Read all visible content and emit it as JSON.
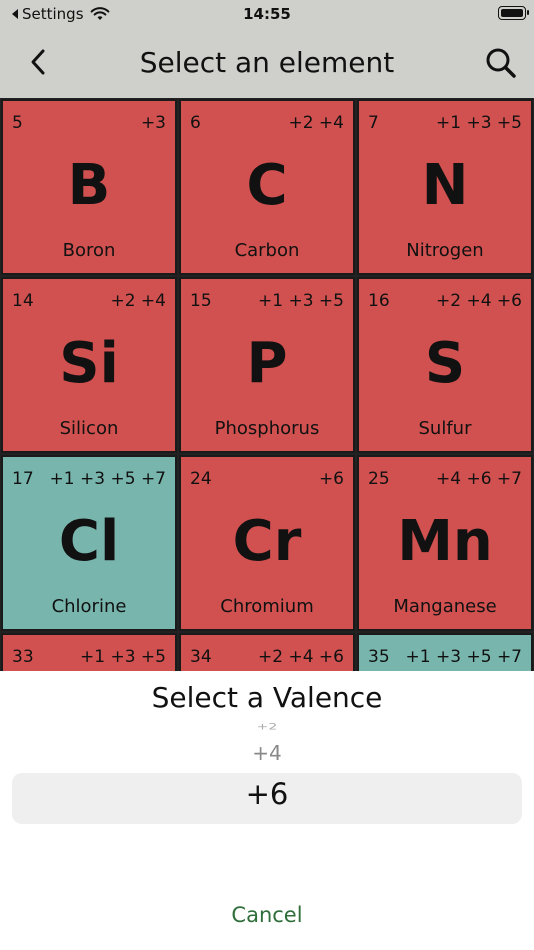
{
  "status_bar": {
    "back_app": "Settings",
    "time": "14:55"
  },
  "nav": {
    "title": "Select an element",
    "back_icon": "chevron-left-icon",
    "search_icon": "search-icon"
  },
  "colors": {
    "nonmetal": "#d05150",
    "halogen": "#78b6ad",
    "accent": "#2f6e3a"
  },
  "elements": [
    {
      "number": "5",
      "valences": "+3",
      "symbol": "B",
      "name": "Boron",
      "category": "red"
    },
    {
      "number": "6",
      "valences": "+2 +4",
      "symbol": "C",
      "name": "Carbon",
      "category": "red"
    },
    {
      "number": "7",
      "valences": "+1 +3 +5",
      "symbol": "N",
      "name": "Nitrogen",
      "category": "red"
    },
    {
      "number": "14",
      "valences": "+2 +4",
      "symbol": "Si",
      "name": "Silicon",
      "category": "red"
    },
    {
      "number": "15",
      "valences": "+1 +3 +5",
      "symbol": "P",
      "name": "Phosphorus",
      "category": "red"
    },
    {
      "number": "16",
      "valences": "+2 +4 +6",
      "symbol": "S",
      "name": "Sulfur",
      "category": "red"
    },
    {
      "number": "17",
      "valences": "+1 +3 +5 +7",
      "symbol": "Cl",
      "name": "Chlorine",
      "category": "teal"
    },
    {
      "number": "24",
      "valences": "+6",
      "symbol": "Cr",
      "name": "Chromium",
      "category": "red"
    },
    {
      "number": "25",
      "valences": "+4 +6 +7",
      "symbol": "Mn",
      "name": "Manganese",
      "category": "red"
    },
    {
      "number": "33",
      "valences": "+1 +3 +5",
      "symbol": "",
      "name": "",
      "category": "red"
    },
    {
      "number": "34",
      "valences": "+2 +4 +6",
      "symbol": "",
      "name": "",
      "category": "red"
    },
    {
      "number": "35",
      "valences": "+1 +3 +5 +7",
      "symbol": "",
      "name": "",
      "category": "teal"
    }
  ],
  "valence_picker": {
    "title": "Select a Valence",
    "options_visible": [
      "+2",
      "+4",
      "+6"
    ],
    "selected": "+6",
    "cancel_label": "Cancel"
  }
}
